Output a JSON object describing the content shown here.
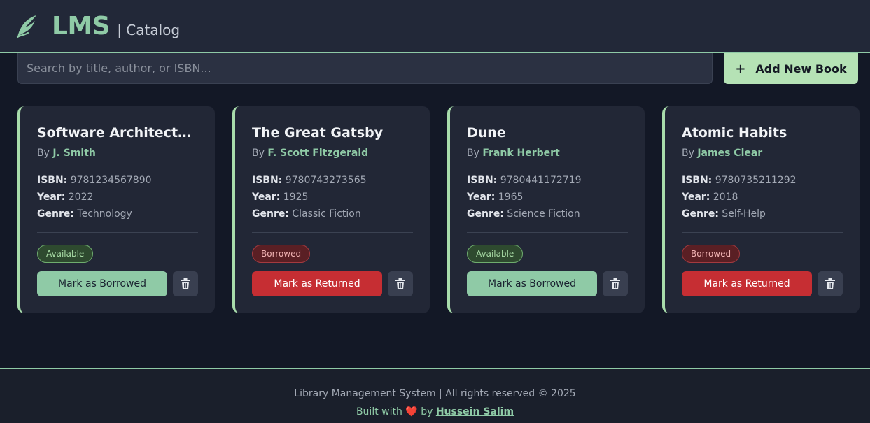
{
  "header": {
    "brand": "LMS",
    "subtitle": "| Catalog"
  },
  "toolbar": {
    "search_placeholder": "Search by title, author, or ISBN...",
    "add_plus": "+",
    "add_label": "Add New Book"
  },
  "labels": {
    "by": "By",
    "isbn": "ISBN:",
    "year": "Year:",
    "genre": "Genre:"
  },
  "books": [
    {
      "title": "Software Architecture...",
      "author": "J. Smith",
      "isbn": "9781234567890",
      "year": "2022",
      "genre": "Technology",
      "status": "Available",
      "status_type": "available",
      "action": "Mark as Borrowed",
      "action_type": "borrow"
    },
    {
      "title": "The Great Gatsby",
      "author": "F. Scott Fitzgerald",
      "isbn": "9780743273565",
      "year": "1925",
      "genre": "Classic Fiction",
      "status": "Borrowed",
      "status_type": "borrowed",
      "action": "Mark as Returned",
      "action_type": "return"
    },
    {
      "title": "Dune",
      "author": "Frank Herbert",
      "isbn": "9780441172719",
      "year": "1965",
      "genre": "Science Fiction",
      "status": "Available",
      "status_type": "available",
      "action": "Mark as Borrowed",
      "action_type": "borrow"
    },
    {
      "title": "Atomic Habits",
      "author": "James Clear",
      "isbn": "9780735211292",
      "year": "2018",
      "genre": "Self-Help",
      "status": "Borrowed",
      "status_type": "borrowed",
      "action": "Mark as Returned",
      "action_type": "return"
    }
  ],
  "footer": {
    "copyright": "Library Management System | All rights reserved © 2025",
    "built_with": "Built with",
    "heart": "❤️",
    "by": "by",
    "author": "Hussein Salim"
  },
  "colors": {
    "accent": "#8fcaa6",
    "available": "#a9dca6",
    "borrowed": "#c62e33"
  }
}
